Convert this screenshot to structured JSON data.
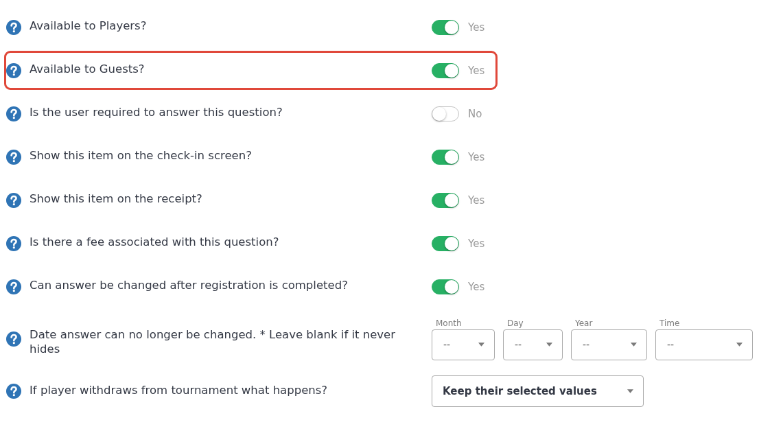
{
  "rows": [
    {
      "kind": "toggle",
      "label": "Available to Players?",
      "on": true,
      "value_label": "Yes",
      "highlighted": false
    },
    {
      "kind": "toggle",
      "label": "Available to Guests?",
      "on": true,
      "value_label": "Yes",
      "highlighted": true
    },
    {
      "kind": "toggle",
      "label": "Is the user required to answer this question?",
      "on": false,
      "value_label": "No",
      "highlighted": false
    },
    {
      "kind": "toggle",
      "label": "Show this item on the check-in screen?",
      "on": true,
      "value_label": "Yes",
      "highlighted": false
    },
    {
      "kind": "toggle",
      "label": "Show this item on the receipt?",
      "on": true,
      "value_label": "Yes",
      "highlighted": false
    },
    {
      "kind": "toggle",
      "label": "Is there a fee associated with this question?",
      "on": true,
      "value_label": "Yes",
      "highlighted": false
    },
    {
      "kind": "toggle",
      "label": "Can answer be changed after registration is completed?",
      "on": true,
      "value_label": "Yes",
      "highlighted": false
    },
    {
      "kind": "date",
      "label": "Date answer can no longer be changed. * Leave blank if it never hides",
      "highlighted": false,
      "fields": [
        {
          "label": "Month",
          "value": "--"
        },
        {
          "label": "Day",
          "value": "--"
        },
        {
          "label": "Year",
          "value": "--"
        },
        {
          "label": "Time",
          "value": "--"
        }
      ]
    },
    {
      "kind": "select",
      "label": "If player withdraws from tournament what happens?",
      "value": "Keep their selected values",
      "highlighted": false
    }
  ]
}
